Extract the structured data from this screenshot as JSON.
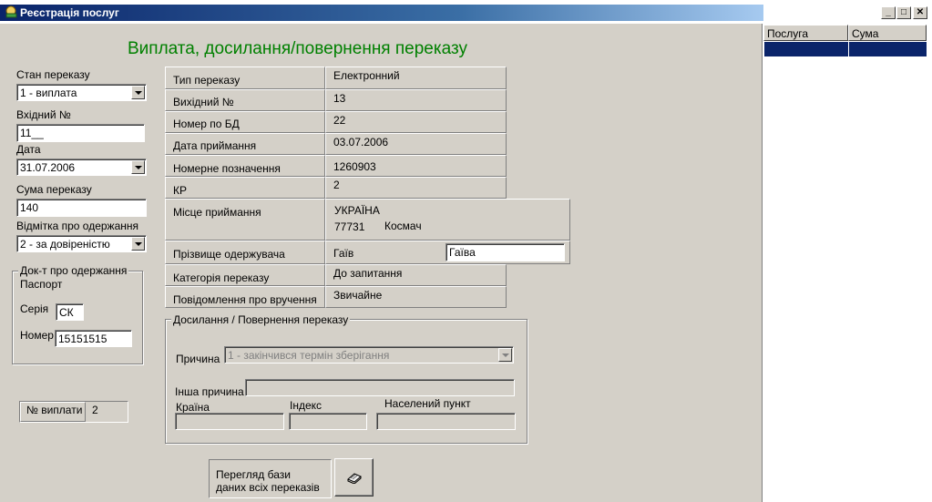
{
  "window": {
    "title": "Реєстрація послуг",
    "min_glyph": "_",
    "max_glyph": "□",
    "close_glyph": "✕"
  },
  "form": {
    "title": "Виплата, досилання/повернення переказу",
    "left": {
      "status_label": "Стан переказу",
      "status_value": "1 - виплата",
      "incoming_label": "Вхідний №",
      "incoming_value": "11__",
      "date_label": "Дата",
      "date_value": "31.07.2006",
      "amount_label": "Сума переказу",
      "amount_value": "140",
      "receipt_label": "Відмітка про одержання",
      "receipt_value": "2 - за довіреністю",
      "doc_group": {
        "caption": "Док-т про одержання",
        "doc_type": "Паспорт",
        "series_label": "Серія",
        "series_value": "СК",
        "number_label": "Номер",
        "number_value": "15151515"
      },
      "payout_label": "№ виплати",
      "payout_value": "2"
    },
    "info": {
      "rows": [
        {
          "label": "Тип переказу",
          "value": "Електронний"
        },
        {
          "label": "Вихідний №",
          "value": "13"
        },
        {
          "label": "Номер по БД",
          "value": "22"
        },
        {
          "label": "Дата приймання",
          "value": "03.07.2006"
        },
        {
          "label": "Номерне позначення",
          "value": "1260903"
        },
        {
          "label": "КР",
          "value": "2"
        }
      ],
      "place_label": "Місце приймання",
      "place_country": "УКРАЇНА",
      "place_index": "77731",
      "place_city": "Космач",
      "surname_label": "Прізвище одержувача",
      "surname_value": "Гаїв",
      "surname_input": "Гаїва",
      "category_label": "Категорія переказу",
      "category_value": "До запитання",
      "notice_label": "Повідомлення  про  вручення",
      "notice_value": "Звичайне"
    },
    "forward_group": {
      "caption": "Досилання / Повернення переказу",
      "reason_label": "Причина",
      "reason_value": "1 - закінчився термін зберігання",
      "other_reason_label": "Інша причина",
      "other_reason_value": "",
      "country_label": "Країна",
      "index_label": "Індекс",
      "city_label": "Населений пункт",
      "country_value": "",
      "index_value": "",
      "city_value": ""
    },
    "browse_button": {
      "line1": "Перегляд бази",
      "line2": "даних всіх переказів"
    }
  },
  "services_grid": {
    "columns": [
      "Послуга",
      "Сума"
    ]
  },
  "colors": {
    "title_green": "#008000",
    "selection": "#0a246a",
    "face": "#d4d0c8"
  }
}
